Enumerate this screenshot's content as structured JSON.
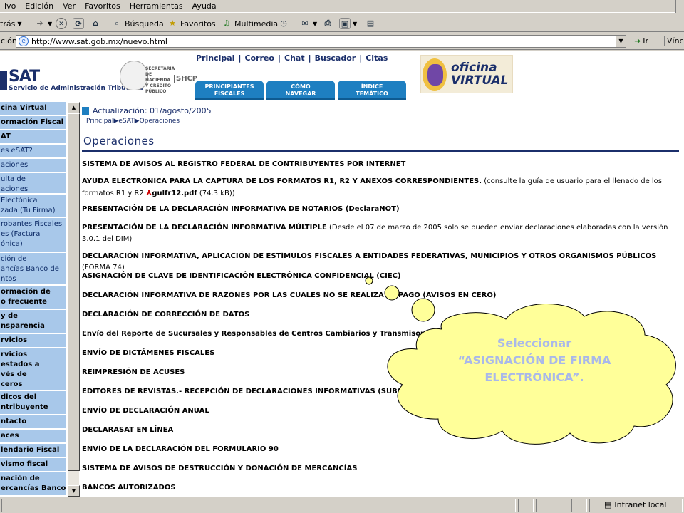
{
  "browser": {
    "menu": [
      "ivo",
      "Edición",
      "Ver",
      "Favoritos",
      "Herramientas",
      "Ayuda"
    ],
    "toolbar": {
      "back": "trás",
      "search": "Búsqueda",
      "favorites": "Favoritos",
      "multimedia": "Multimedia"
    },
    "address": {
      "label": "ción",
      "url": "http://www.sat.gob.mx/nuevo.html",
      "go": "Ir",
      "links": "Víncu"
    },
    "status": {
      "zone": "Intranet local"
    }
  },
  "header": {
    "logo_text": "SAT",
    "logo_sub": "Servicio de Administración Tributaria",
    "hacienda": "SECRETARÍA DE HACIENDA Y CRÉDITO PÚBLICO",
    "shcp": "SHCP",
    "topnav": [
      "Principal",
      "Correo",
      "Chat",
      "Buscador",
      "Citas"
    ],
    "tabs": [
      {
        "line1": "PRINCIPIANTES",
        "line2": "FISCALES"
      },
      {
        "line1": "CÓMO",
        "line2": "NAVEGAR"
      },
      {
        "line1": "ÍNDICE",
        "line2": "TEMÁTICO"
      }
    ],
    "oficina_virtual": {
      "line1": "oficina",
      "line2": "VIRTUAL"
    }
  },
  "sidebar": [
    {
      "label": "cina Virtual",
      "bold": true
    },
    {
      "label": "ormación Fiscal",
      "bold": true
    },
    {
      "label": "AT",
      "bold": true
    },
    {
      "label": "es eSAT?",
      "bold": false
    },
    {
      "label": "aciones",
      "bold": false
    },
    {
      "label": "ulta de\naciones",
      "bold": false
    },
    {
      "label": "Electónica\nzada (Tu Firma)",
      "bold": false
    },
    {
      "label": "robantes Fiscales\nes (Factura\nónica)",
      "bold": false
    },
    {
      "label": "ción de\nancías Banco de\nntos",
      "bold": false
    },
    {
      "label": "ormación de\no frecuente",
      "bold": true
    },
    {
      "label": "y de\nnsparencia",
      "bold": true
    },
    {
      "label": "rvicios",
      "bold": true
    },
    {
      "label": "rvicios\nestados a\nvés de\nceros",
      "bold": true
    },
    {
      "label": "dicos del\nntribuyente",
      "bold": true
    },
    {
      "label": "ntacto",
      "bold": true
    },
    {
      "label": "aces",
      "bold": true
    },
    {
      "label": "lendario Fiscal",
      "bold": true
    },
    {
      "label": "vismo fiscal",
      "bold": true
    },
    {
      "label": "nación de\nercancías Banco",
      "bold": true
    }
  ],
  "main": {
    "update": "Actualización: 01/agosto/2005",
    "crumb": [
      "Principal",
      "eSAT",
      "Operaciones"
    ],
    "title": "Operaciones",
    "items": [
      {
        "bold": "SISTEMA DE AVISOS AL REGISTRO FEDERAL DE CONTRIBUYENTES POR INTERNET",
        "rest": ""
      },
      {
        "bold": "AYUDA ELECTRÓNICA PARA LA CAPTURA DE LOS FORMATOS R1, R2 Y ANEXOS CORRESPONDIENTES.",
        "rest": " (consulte la guía de usuario para el llenado de los formatos R1 y R2 ",
        "pdf": "gulfr12.pdf",
        "tail": " (74.3 kB))"
      },
      {
        "bold": "PRESENTACIÓN DE LA DECLARACIÓN INFORMATIVA DE NOTARIOS (DeclaraNOT)",
        "rest": ""
      },
      {
        "bold": "PRESENTACIÓN DE LA DECLARACIÓN INFORMATIVA MÚLTIPLE",
        "rest": " (Desde el 07 de marzo de 2005 sólo se pueden enviar declaraciones elaboradas con la versión 3.0.1 del DIM)"
      },
      {
        "bold": "DECLARACIÓN INFORMATIVA, APLICACIÓN DE ESTÍMULOS FISCALES A ENTIDADES FEDERATIVAS, MUNICIPIOS Y OTROS ORGANISMOS PÚBLICOS",
        "rest": " (FORMA 74)"
      },
      {
        "bold": "ASIGNACIÓN DE CLAVE DE IDENTIFICACIÓN ELECTRÓNICA CONFIDENCIAL (CIEC)",
        "rest": ""
      },
      {
        "bold": "DECLARACIÓN INFORMATIVA DE RAZONES POR LAS CUALES NO SE REALIZA EL PAGO (AVISOS EN CERO)",
        "rest": ""
      },
      {
        "bold": "DECLARACIÓN DE CORRECCIÓN DE DATOS",
        "rest": ""
      },
      {
        "bold": "Envío del Reporte de Sucursales y Responsables de Centros Cambiarios y Transmisores de Dinero",
        "rest": ""
      },
      {
        "bold": "ENVÍO DE DICTÁMENES FISCALES",
        "rest": ""
      },
      {
        "bold": "REIMPRESIÓN DE ACUSES",
        "rest": ""
      },
      {
        "bold": "EDITORES DE REVISTAS.- RECEPCIÓN DE DECLARACIONES INFORMATIVAS (SUBSIDIO)",
        "rest": ""
      },
      {
        "bold": "ENVÍO DE DECLARACIÓN ANUAL",
        "rest": ""
      },
      {
        "bold": "DECLARASAT EN LÍNEA",
        "rest": ""
      },
      {
        "bold": "ENVÍO DE LA DECLARACIÓN DEL FORMULARIO 90",
        "rest": ""
      },
      {
        "bold": "SISTEMA DE AVISOS DE DESTRUCCIÓN Y DONACIÓN DE MERCANCÍAS",
        "rest": ""
      },
      {
        "bold": "BANCOS AUTORIZADOS",
        "rest": ""
      }
    ]
  },
  "callout": {
    "line1": "Seleccionar",
    "line2": "“ASIGNACIÓN  DE FIRMA",
    "line3": "ELECTRÓNICA”."
  },
  "colors": {
    "brand": "#1b2f6b",
    "tab": "#1e7fc1",
    "sidebar": "#a8c8ea",
    "cloud": "#ffff99",
    "cloud_text": "#a9b8ea"
  }
}
